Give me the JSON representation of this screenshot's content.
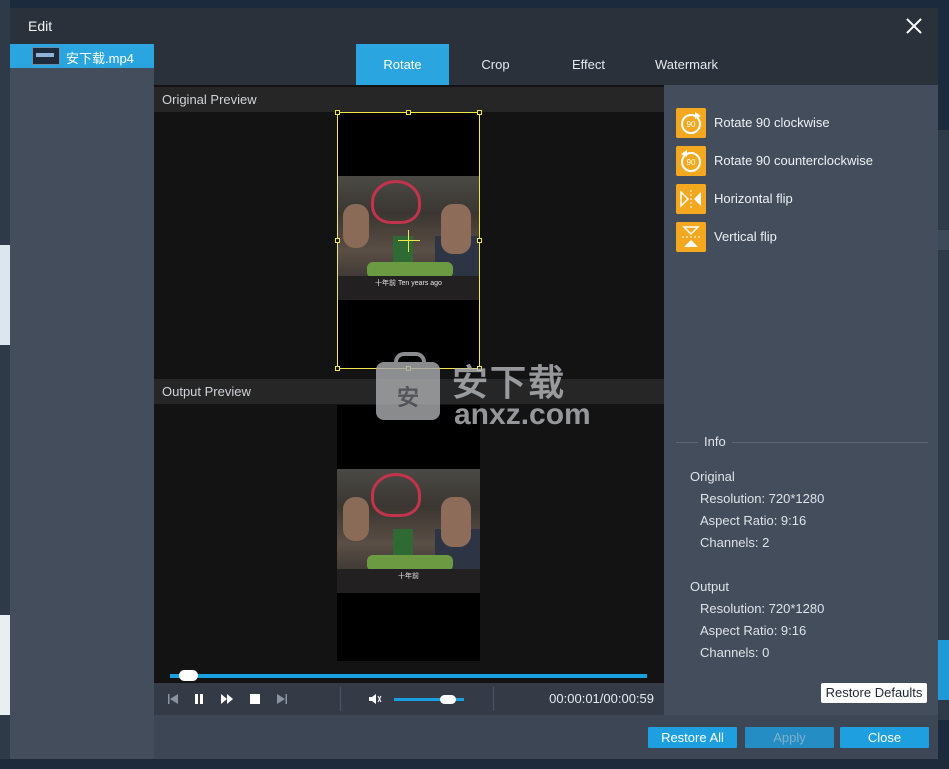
{
  "window": {
    "title": "Edit"
  },
  "sidebar": {
    "files": [
      {
        "name": "安下载.mp4",
        "selected": true
      }
    ]
  },
  "tabs": [
    {
      "label": "Rotate",
      "active": true
    },
    {
      "label": "Crop",
      "active": false
    },
    {
      "label": "Effect",
      "active": false
    },
    {
      "label": "Watermark",
      "active": false
    }
  ],
  "preview": {
    "original_label": "Original Preview",
    "output_label": "Output Preview",
    "subtitle_original": "十年前 Ten years ago",
    "subtitle_output": "十年前",
    "watermark_cn": "安下载",
    "watermark_en": "anxz.com",
    "watermark_badge": "安"
  },
  "player": {
    "timecode": "00:00:01/00:00:59",
    "progress_fraction": 0.02,
    "volume_fraction": 0.85
  },
  "actions": [
    {
      "label": "Rotate 90 clockwise",
      "icon": "rotate-clockwise-icon",
      "badge": "90"
    },
    {
      "label": "Rotate 90 counterclockwise",
      "icon": "rotate-counterclockwise-icon",
      "badge": "90"
    },
    {
      "label": "Horizontal flip",
      "icon": "horizontal-flip-icon"
    },
    {
      "label": "Vertical flip",
      "icon": "vertical-flip-icon"
    }
  ],
  "info": {
    "title": "Info",
    "original": {
      "heading": "Original",
      "resolution": "Resolution: 720*1280",
      "aspect_ratio": "Aspect Ratio: 9:16",
      "channels": "Channels: 2"
    },
    "output": {
      "heading": "Output",
      "resolution": "Resolution: 720*1280",
      "aspect_ratio": "Aspect Ratio: 9:16",
      "channels": "Channels: 0"
    }
  },
  "buttons": {
    "restore_defaults": "Restore Defaults",
    "restore_all": "Restore All",
    "apply": "Apply",
    "close": "Close"
  },
  "colors": {
    "accent": "#1e9fe0",
    "icon_bg": "#f3a81f",
    "crop_frame": "#f2e64a"
  }
}
